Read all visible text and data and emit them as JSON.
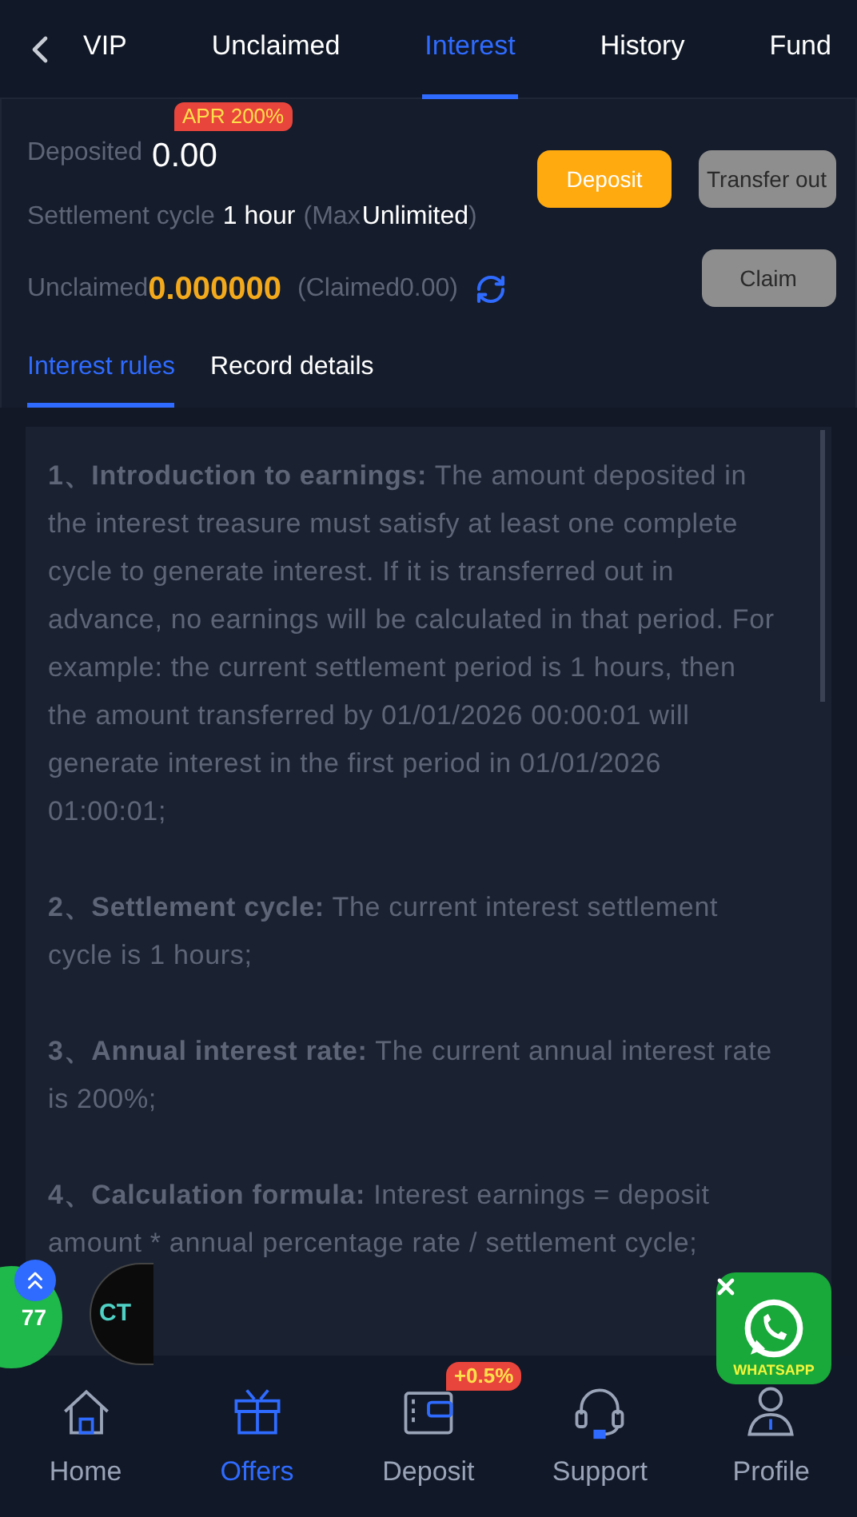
{
  "nav": {
    "tabs": [
      {
        "label": "VIP",
        "selected": false
      },
      {
        "label": "Unclaimed",
        "selected": false
      },
      {
        "label": "Interest",
        "selected": true
      },
      {
        "label": "History",
        "selected": false
      },
      {
        "label": "Fund",
        "selected": false
      }
    ]
  },
  "summary": {
    "apr_badge": "APR 200%",
    "deposited_label": "Deposited",
    "deposited_value": "0.00",
    "settlement_label": "Settlement cycle",
    "settlement_value": "1 hour",
    "max_open": "(Max",
    "max_value": "Unlimited",
    "max_close": ")",
    "unclaimed_label": "Unclaimed",
    "unclaimed_value": "0.000000",
    "claimed": "(Claimed0.00)",
    "buttons": [
      {
        "label": "Deposit",
        "kind": "primary"
      },
      {
        "label": "Transfer out",
        "kind": "secondary"
      },
      {
        "label": "Claim",
        "kind": "secondary"
      }
    ]
  },
  "subtabs": [
    {
      "label": "Interest rules",
      "selected": true
    },
    {
      "label": "Record details",
      "selected": false
    }
  ],
  "rules": [
    {
      "title": "1、Introduction to earnings:",
      "text": " The amount deposited in the interest treasure must satisfy at least one complete cycle to generate interest. If it is transferred out in advance, no earnings will be calculated in that period. For example: the current settlement period is 1 hours, then the amount transferred by 01/01/2026 00:00:01 will generate interest in the first period in 01/01/2026 01:00:01;"
    },
    {
      "title": "2、Settlement cycle:",
      "text": " The current interest settlement cycle is 1 hours;"
    },
    {
      "title": "3、Annual interest rate:",
      "text": " The current annual interest rate is 200%;"
    },
    {
      "title": "4、Calculation formula:",
      "text": " Interest earnings = deposit amount * annual percentage rate / settlement cycle;"
    }
  ],
  "floating": {
    "left_badges": [
      {
        "label": "77"
      },
      {
        "label": "CT"
      }
    ],
    "whatsapp_label": "WHATSAPP"
  },
  "bottom_nav": [
    {
      "label": "Home",
      "kind": "home",
      "selected": false
    },
    {
      "label": "Offers",
      "kind": "gift",
      "selected": true
    },
    {
      "label": "Deposit",
      "kind": "wallet",
      "selected": false,
      "badge": "+0.5%"
    },
    {
      "label": "Support",
      "kind": "headset",
      "selected": false
    },
    {
      "label": "Profile",
      "kind": "person",
      "selected": false
    }
  ]
}
